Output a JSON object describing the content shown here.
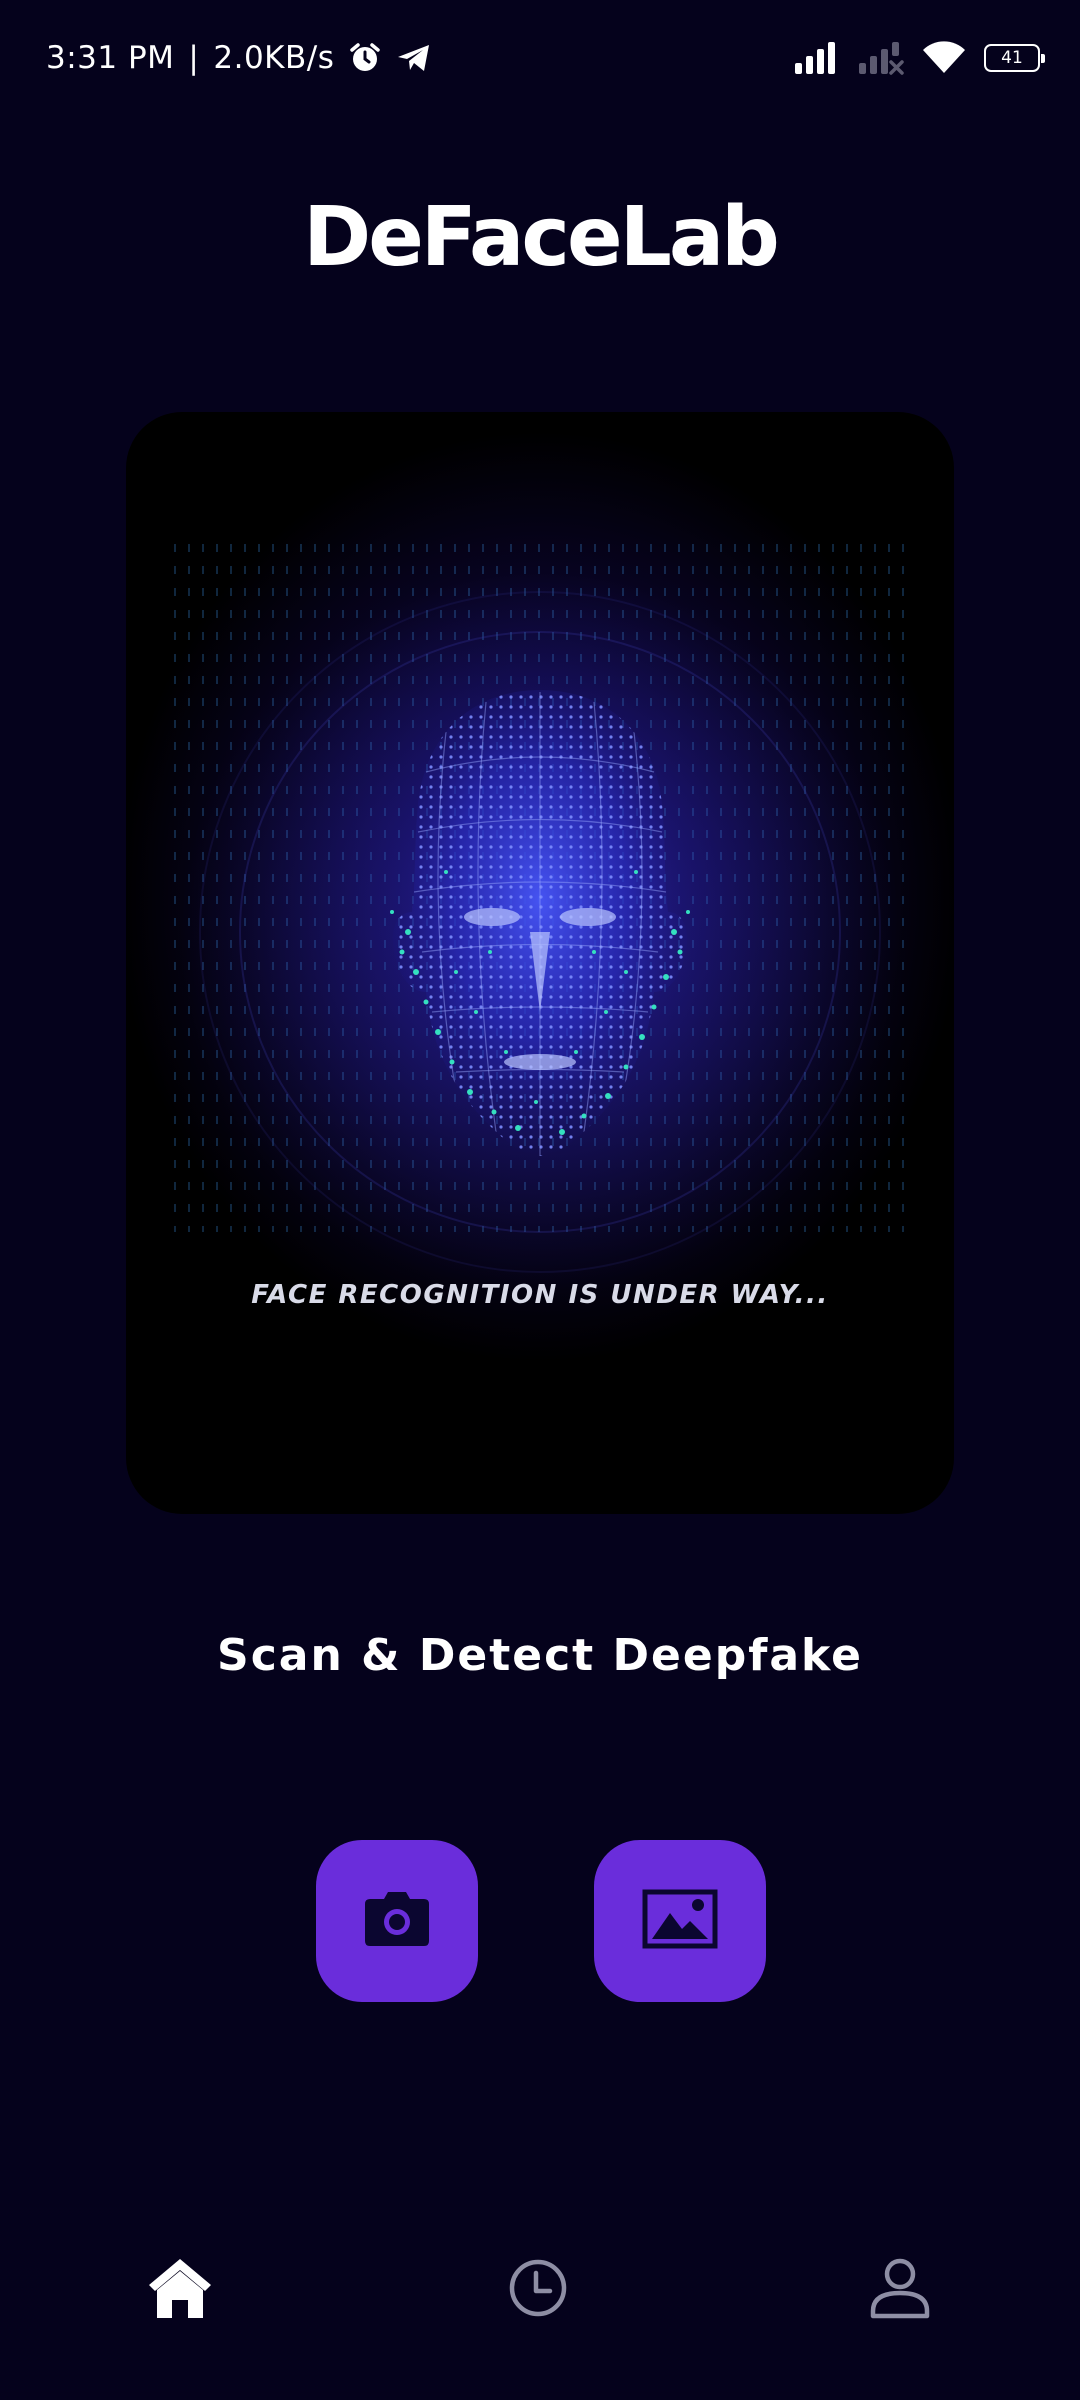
{
  "status_bar": {
    "time": "3:31 PM",
    "separator": "|",
    "network_speed": "2.0KB/s",
    "battery_level": "41",
    "icons": [
      "alarm-icon",
      "telegram-icon",
      "signal-icon",
      "signal-no-service-icon",
      "wifi-icon",
      "battery-icon"
    ]
  },
  "app": {
    "title": "DeFaceLab"
  },
  "hero": {
    "image": "face-scan-hologram",
    "caption": "FACE RECOGNITION IS UNDER WAY..."
  },
  "main": {
    "subtitle": "Scan & Detect Deepfake"
  },
  "actions": [
    {
      "icon": "camera-icon"
    },
    {
      "icon": "image-gallery-icon"
    }
  ],
  "bottom_nav": {
    "items": [
      {
        "icon": "home-icon",
        "active": true
      },
      {
        "icon": "history-clock-icon",
        "active": false
      },
      {
        "icon": "profile-icon",
        "active": false
      }
    ]
  },
  "colors": {
    "background": "#05021c",
    "accent": "#6a2ddb",
    "text": "#ffffff",
    "inactive_icon": "#8e8ea4",
    "hologram_blue": "#3a50ff",
    "hologram_teal": "#35e0c0"
  }
}
